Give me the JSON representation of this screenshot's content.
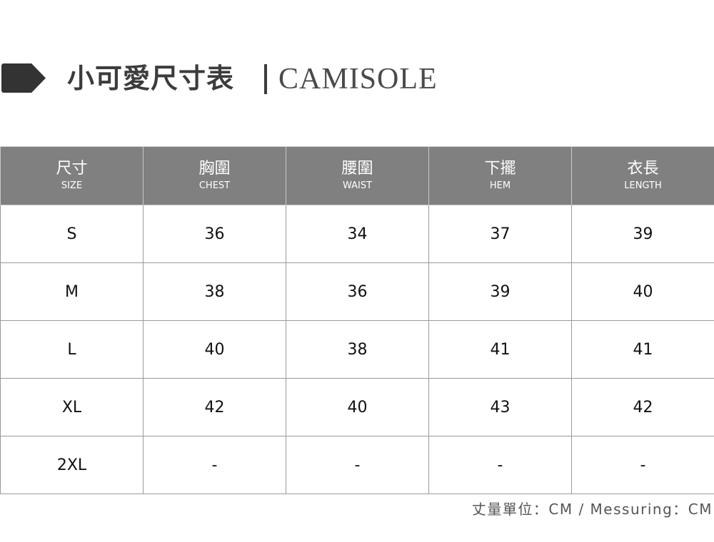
{
  "title": {
    "icon": "tag-arrow-icon",
    "chinese": "小可愛尺寸表",
    "separator": "|",
    "english": "CAMISOLE"
  },
  "table": {
    "headers": [
      {
        "cn": "尺寸",
        "en": "SIZE"
      },
      {
        "cn": "胸圍",
        "en": "CHEST"
      },
      {
        "cn": "腰圍",
        "en": "WAIST"
      },
      {
        "cn": "下擺",
        "en": "HEM"
      },
      {
        "cn": "衣長",
        "en": "LENGTH"
      }
    ],
    "rows": [
      [
        "S",
        "36",
        "34",
        "37",
        "39"
      ],
      [
        "M",
        "38",
        "36",
        "39",
        "40"
      ],
      [
        "L",
        "40",
        "38",
        "41",
        "41"
      ],
      [
        "XL",
        "42",
        "40",
        "43",
        "42"
      ],
      [
        "2XL",
        "-",
        "-",
        "-",
        "-"
      ]
    ]
  },
  "note": "丈量單位：CM / Messuring：CM",
  "colors": {
    "header_bg": "#808080",
    "title_text": "#3c3c3c",
    "border": "#9a9a9a"
  }
}
